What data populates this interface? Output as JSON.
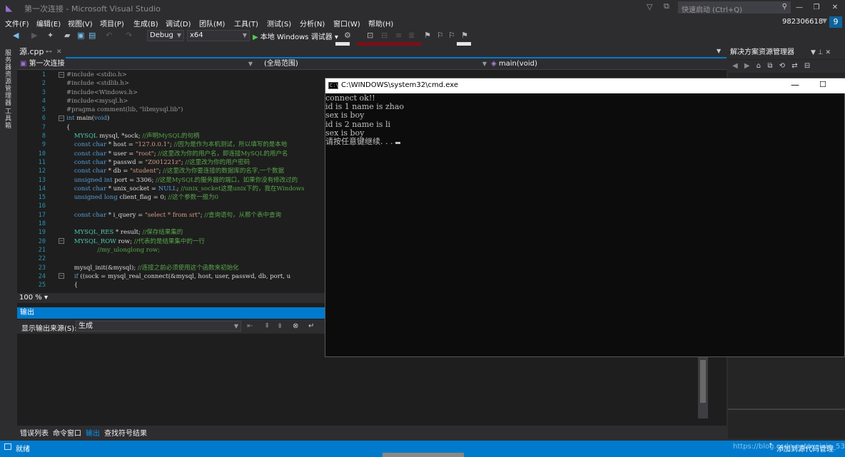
{
  "window": {
    "title": "第一次连接 - Microsoft Visual Studio",
    "quick_launch": "快速启动 (Ctrl+Q)",
    "user": "982306618",
    "badge": "9"
  },
  "menu": [
    "文件(F)",
    "编辑(E)",
    "视图(V)",
    "项目(P)",
    "生成(B)",
    "调试(D)",
    "团队(M)",
    "工具(T)",
    "测试(S)",
    "分析(N)",
    "窗口(W)",
    "帮助(H)"
  ],
  "toolbar": {
    "config": "Debug",
    "platform": "x64",
    "start": "本地 Windows 调试器"
  },
  "left_tabs": [
    "服务器资源管理器",
    "工具箱"
  ],
  "editor": {
    "tab": "源.cpp",
    "nav_project": "第一次连接",
    "nav_scope": "(全局范围)",
    "nav_member": "main(void)",
    "zoom": "100 %",
    "line_numbers": [
      "1",
      "2",
      "3",
      "4",
      "5",
      "6",
      "7",
      "8",
      "9",
      "10",
      "11",
      "12",
      "13",
      "14",
      "15",
      "16",
      "17",
      "18",
      "19",
      "20",
      "21",
      "22",
      "23",
      "24",
      "25"
    ]
  },
  "code": [
    [
      {
        "t": "#include <stdio.h>",
        "c": "pp"
      }
    ],
    [
      {
        "t": "#include <stdlib.h>",
        "c": "pp"
      }
    ],
    [
      {
        "t": "#include<Windows.h>",
        "c": "pp"
      }
    ],
    [
      {
        "t": "#include<mysql.h>",
        "c": "pp"
      }
    ],
    [
      {
        "t": "#pragma comment(lib, \"libmysql.lib\")",
        "c": "pp"
      }
    ],
    [
      {
        "t": "int",
        "c": "kw"
      },
      {
        "t": " main(",
        "c": ""
      },
      {
        "t": "void",
        "c": "kw"
      },
      {
        "t": ")",
        "c": ""
      }
    ],
    [
      {
        "t": "{",
        "c": ""
      }
    ],
    [
      {
        "t": "    ",
        "c": ""
      },
      {
        "t": "MYSQL",
        "c": "ty"
      },
      {
        "t": " mysql, *sock; ",
        "c": ""
      },
      {
        "t": "//声明MySQL的句柄",
        "c": "cm"
      }
    ],
    [
      {
        "t": "    ",
        "c": ""
      },
      {
        "t": "const char",
        "c": "kw"
      },
      {
        "t": " * host = ",
        "c": ""
      },
      {
        "t": "\"127.0.0.1\"",
        "c": "str"
      },
      {
        "t": "; ",
        "c": ""
      },
      {
        "t": "//因为是作为本机测试，所以填写的是本地",
        "c": "cm"
      }
    ],
    [
      {
        "t": "    ",
        "c": ""
      },
      {
        "t": "const char",
        "c": "kw"
      },
      {
        "t": " * user = ",
        "c": ""
      },
      {
        "t": "\"root\"",
        "c": "str"
      },
      {
        "t": "; ",
        "c": ""
      },
      {
        "t": "//这里改为你的用户名，即连接MySQL的用户名",
        "c": "cm"
      }
    ],
    [
      {
        "t": "    ",
        "c": ""
      },
      {
        "t": "const char",
        "c": "kw"
      },
      {
        "t": " * passwd = ",
        "c": ""
      },
      {
        "t": "\"Z001221z\"",
        "c": "str"
      },
      {
        "t": "; ",
        "c": ""
      },
      {
        "t": "//这里改为你的用户密码",
        "c": "cm"
      }
    ],
    [
      {
        "t": "    ",
        "c": ""
      },
      {
        "t": "const char",
        "c": "kw"
      },
      {
        "t": " * db = ",
        "c": ""
      },
      {
        "t": "\"student\"",
        "c": "str"
      },
      {
        "t": "; ",
        "c": ""
      },
      {
        "t": "//这里改为你要连接的数据库的名字,一个数据",
        "c": "cm"
      }
    ],
    [
      {
        "t": "    ",
        "c": ""
      },
      {
        "t": "unsigned int",
        "c": "kw"
      },
      {
        "t": " port = 3306; ",
        "c": ""
      },
      {
        "t": "//这是MySQL的服务器的端口，如果你没有修改过的",
        "c": "cm"
      }
    ],
    [
      {
        "t": "    ",
        "c": ""
      },
      {
        "t": "const char",
        "c": "kw"
      },
      {
        "t": " * unix_socket = ",
        "c": ""
      },
      {
        "t": "NULL",
        "c": "kw"
      },
      {
        "t": "; ",
        "c": ""
      },
      {
        "t": "//unix_socket这是unix下的，我在Windows",
        "c": "cm"
      }
    ],
    [
      {
        "t": "    ",
        "c": ""
      },
      {
        "t": "unsigned long",
        "c": "kw"
      },
      {
        "t": " client_flag = 0; ",
        "c": ""
      },
      {
        "t": "//这个参数一般为0",
        "c": "cm"
      }
    ],
    [
      {
        "t": "",
        "c": ""
      }
    ],
    [
      {
        "t": "    ",
        "c": ""
      },
      {
        "t": "const char",
        "c": "kw"
      },
      {
        "t": " * i_query = ",
        "c": ""
      },
      {
        "t": "\"select * from srt\"",
        "c": "str"
      },
      {
        "t": "; ",
        "c": ""
      },
      {
        "t": "//查询语句，从那个表中查询",
        "c": "cm"
      }
    ],
    [
      {
        "t": "",
        "c": ""
      }
    ],
    [
      {
        "t": "    ",
        "c": ""
      },
      {
        "t": "MYSQL_RES",
        "c": "ty"
      },
      {
        "t": " * result; ",
        "c": ""
      },
      {
        "t": "//保存结果集的",
        "c": "cm"
      }
    ],
    [
      {
        "t": "    ",
        "c": ""
      },
      {
        "t": "MYSQL_ROW",
        "c": "ty"
      },
      {
        "t": " row; ",
        "c": ""
      },
      {
        "t": "//代表的是结果集中的一行",
        "c": "cm"
      }
    ],
    [
      {
        "t": "                ",
        "c": ""
      },
      {
        "t": "//my_ulonglong row;",
        "c": "cm"
      }
    ],
    [
      {
        "t": "",
        "c": ""
      }
    ],
    [
      {
        "t": "    mysql_init(&mysql); ",
        "c": ""
      },
      {
        "t": "//连接之前必须使用这个函数来初始化",
        "c": "cm"
      }
    ],
    [
      {
        "t": "    ",
        "c": ""
      },
      {
        "t": "if",
        "c": "kw"
      },
      {
        "t": " ((sock = mysql_real_connect(&mysql, host, user, passwd, db, port, u",
        "c": ""
      }
    ],
    [
      {
        "t": "    {",
        "c": ""
      }
    ]
  ],
  "output": {
    "header": "输出",
    "source_label": "显示输出来源(S):",
    "source_value": "生成"
  },
  "bottom_tabs": [
    "错误列表",
    "命令窗口",
    "输出",
    "查找符号结果"
  ],
  "solution_explorer": {
    "title": "解决方案资源管理器"
  },
  "status": {
    "text": "就绪",
    "right": "添加到源代码管理",
    "watermark": "https://blog.csdn.net/weixin_53684486"
  },
  "cmd": {
    "title": "C:\\WINDOWS\\system32\\cmd.exe",
    "lines": [
      "connect ok!!",
      "id is 1 name is zhao",
      "sex is boy",
      "id is 2 name is li",
      "sex is boy",
      "请按任意键继续. . ."
    ]
  }
}
